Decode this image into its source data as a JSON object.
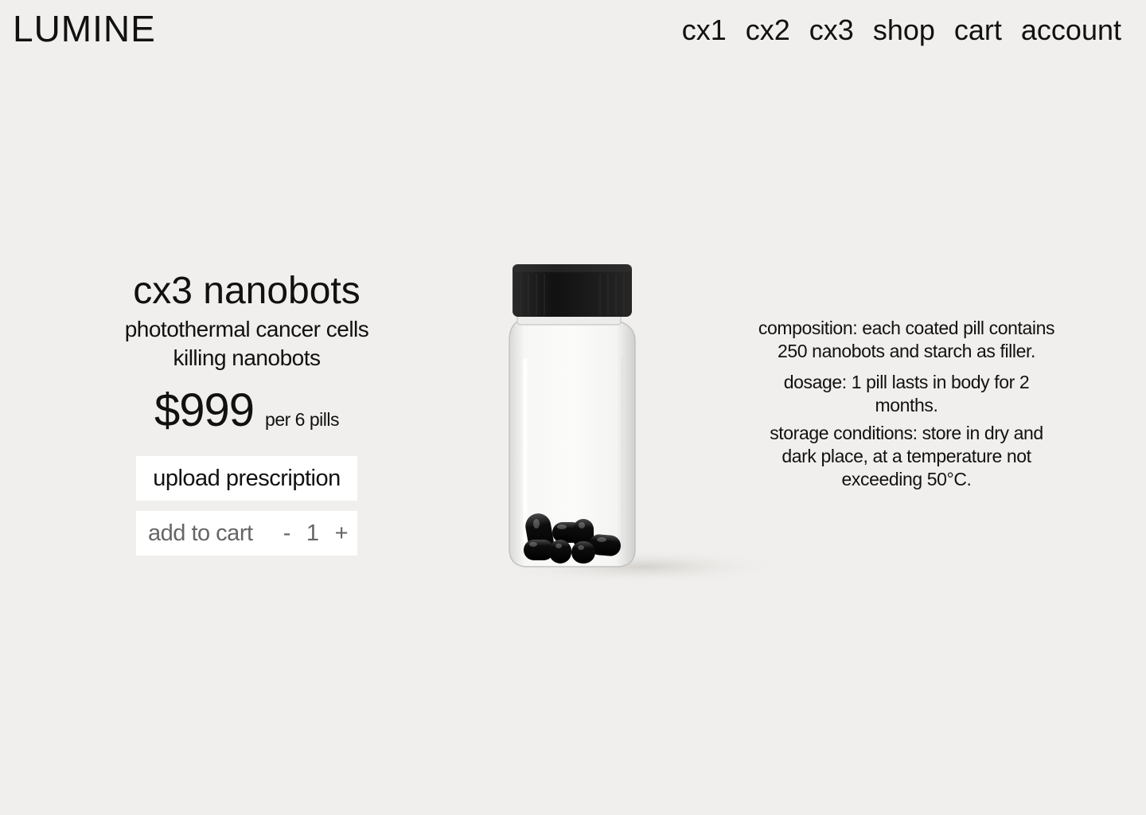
{
  "header": {
    "logo": "LUMINE",
    "nav": [
      {
        "label": "cx1",
        "name": "nav-cx1"
      },
      {
        "label": "cx2",
        "name": "nav-cx2"
      },
      {
        "label": "cx3",
        "name": "nav-cx3"
      },
      {
        "label": "shop",
        "name": "nav-shop"
      },
      {
        "label": "cart",
        "name": "nav-cart"
      },
      {
        "label": "account",
        "name": "nav-account"
      }
    ]
  },
  "product": {
    "title": "cx3 nanobots",
    "subtitle_line1": "photothermal cancer cells",
    "subtitle_line2": "killing nanobots",
    "price": "$999",
    "price_unit": "per 6 pills",
    "upload_label": "upload prescription",
    "add_to_cart_label": "add to cart",
    "decrement": "-",
    "quantity": "1",
    "increment": "+",
    "image_icon": "pill-bottle-icon"
  },
  "details": {
    "composition": "composition: each coated pill contains 250 nanobots and starch as filler.",
    "dosage": "dosage: 1 pill lasts in body for 2 months.",
    "storage": "storage conditions: store in dry and dark place, at a temperature not exceeding 50°C."
  },
  "colors": {
    "background": "#f0efed",
    "text": "#111111",
    "button_bg": "#ffffff",
    "muted_text": "#666666",
    "cap": "#1a1a1a",
    "pill": "#0b0b0b"
  }
}
